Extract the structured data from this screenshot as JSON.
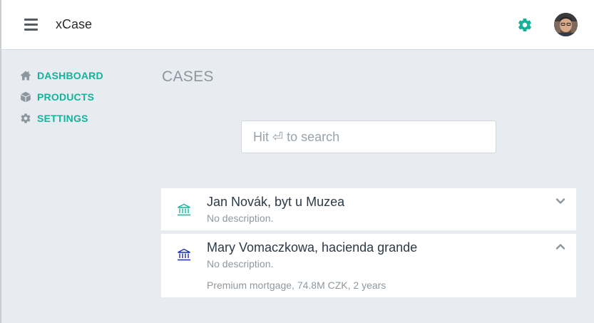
{
  "header": {
    "app_title": "xCase"
  },
  "sidebar": {
    "items": [
      {
        "label": "DASHBOARD",
        "icon": "home-icon"
      },
      {
        "label": "PRODUCTS",
        "icon": "cube-icon"
      },
      {
        "label": "SETTINGS",
        "icon": "gear-icon"
      }
    ]
  },
  "main": {
    "title": "CASES",
    "search": {
      "placeholder": "Hit ⏎ to search",
      "value": ""
    },
    "cases": [
      {
        "title": "Jan Novák, byt u Muzea",
        "description": "No description.",
        "icon": "bank-icon",
        "icon_color": "#13b39b",
        "expanded": false
      },
      {
        "title": "Mary Vomaczkowa, hacienda grande",
        "description": "No description.",
        "detail": "Premium mortgage, 74.8M CZK, 2 years",
        "icon": "bank-icon",
        "icon_color": "#1c2ab8",
        "expanded": true
      }
    ]
  },
  "colors": {
    "accent": "#13b39b",
    "background": "#e8ecf1",
    "card": "#ffffff",
    "muted_text": "#8f989f"
  }
}
